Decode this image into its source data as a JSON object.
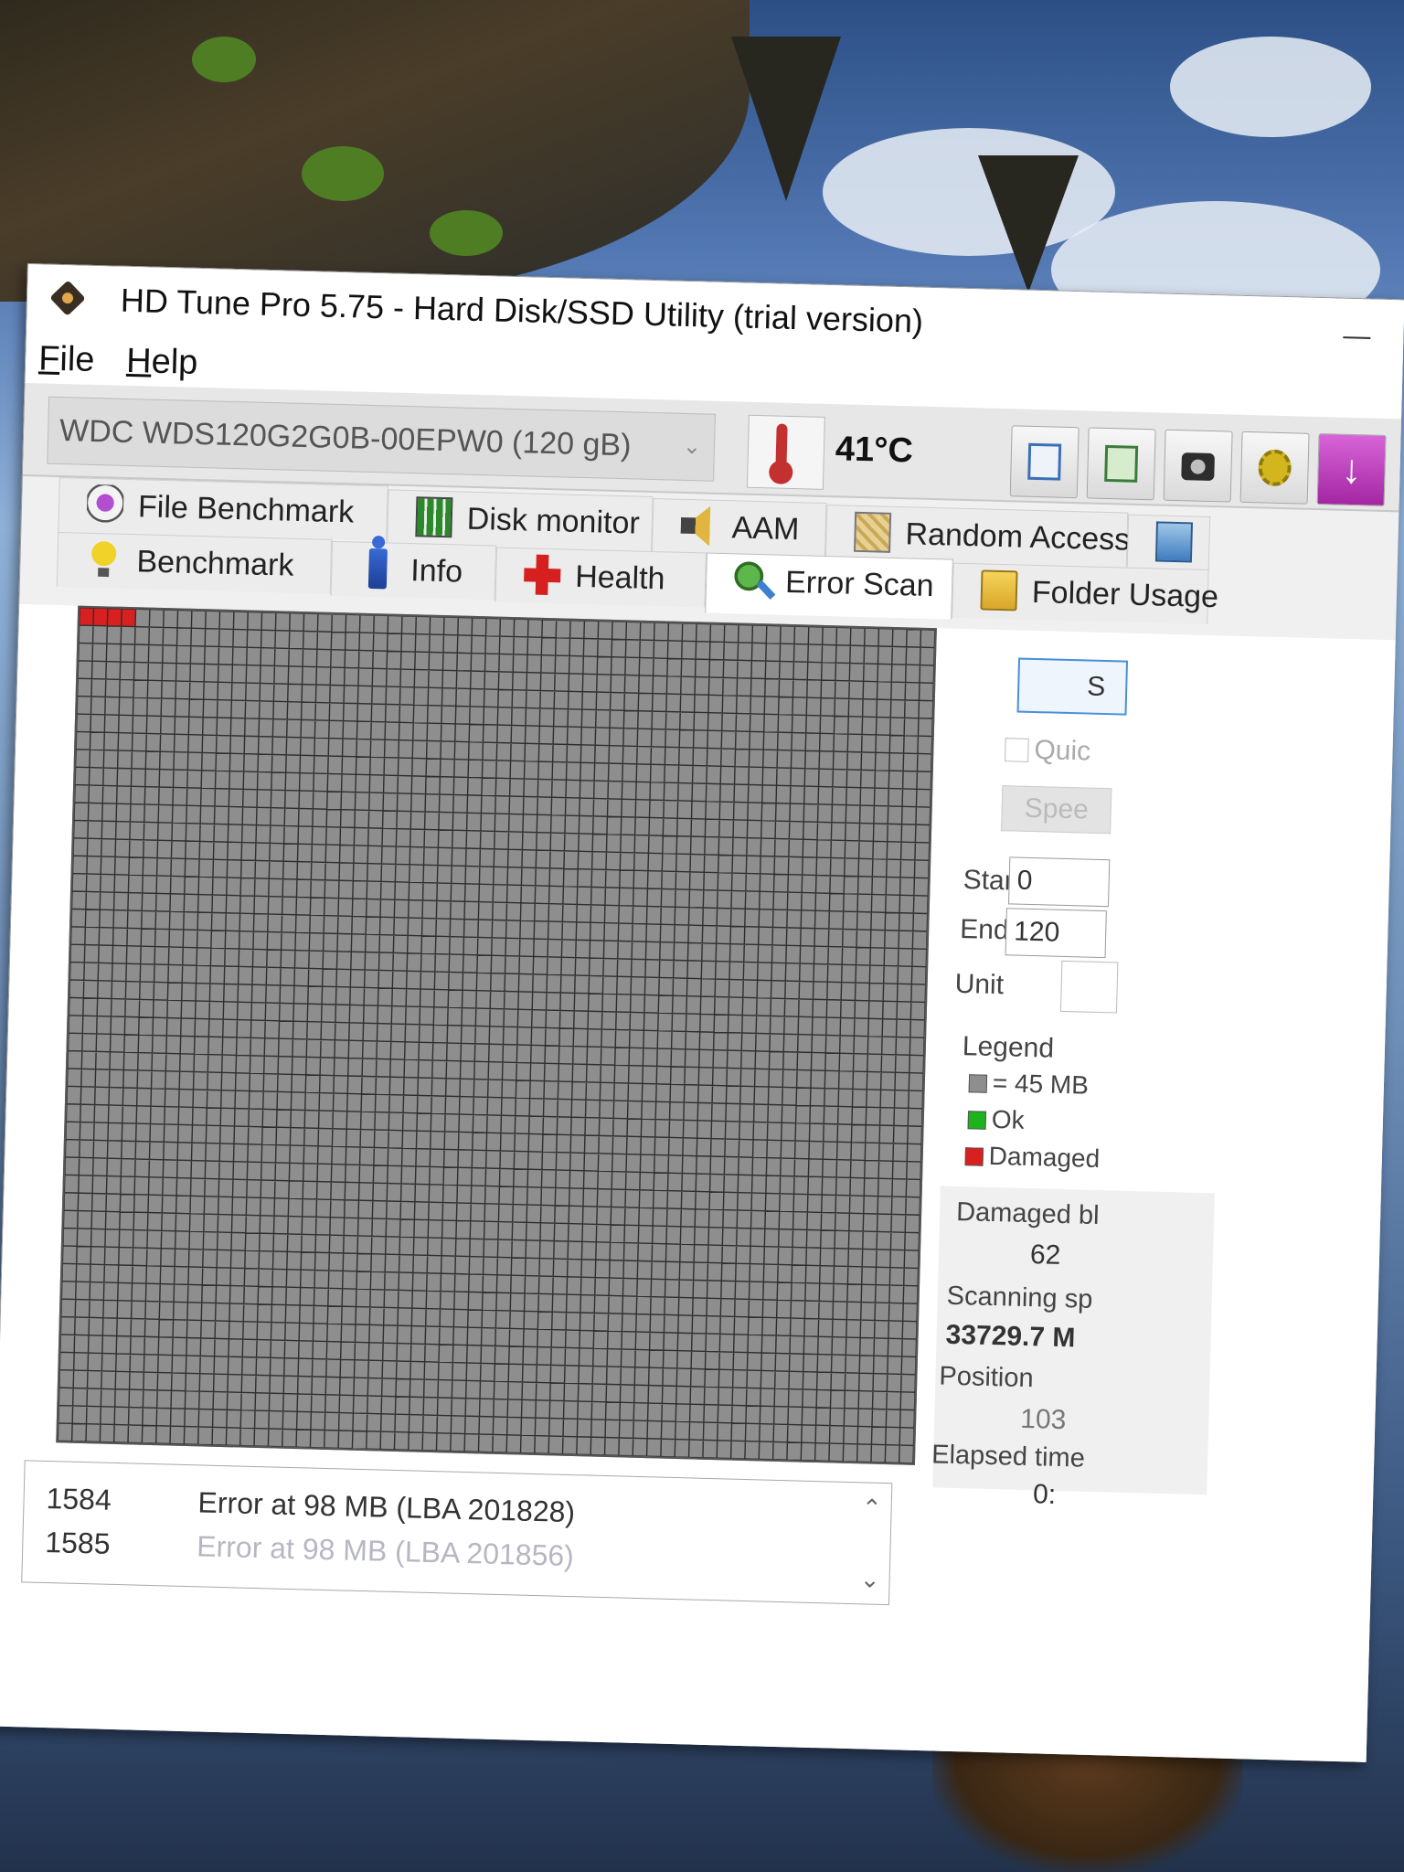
{
  "window": {
    "title": "HD Tune Pro 5.75 - Hard Disk/SSD Utility (trial version)",
    "minimize": "—"
  },
  "menu": {
    "file": "File",
    "help": "Help"
  },
  "toolbar": {
    "drive": "WDC WDS120G2G0B-00EPW0 (120 gB)",
    "dropdown_arrow": "⌄",
    "temperature": "41°C",
    "exit_glyph": "↓"
  },
  "tabs": {
    "row1": [
      "File Benchmark",
      "Disk monitor",
      "AAM",
      "Random Access",
      ""
    ],
    "row2": [
      "Benchmark",
      "Info",
      "Health",
      "Error Scan",
      "Folder Usage"
    ],
    "active": "Error Scan"
  },
  "block_map": {
    "columns": 61,
    "rows": 47,
    "damaged_blocks": 4,
    "colors": {
      "block": "#8e8e8e",
      "gridline": "#2f2f2f",
      "damaged": "#d82020",
      "ok": "#1db31d"
    }
  },
  "log": {
    "rows": [
      {
        "num": "1584",
        "msg": "Error at 98 MB (LBA 201828)"
      },
      {
        "num": "1585",
        "msg": "Error at 98 MB (LBA 201856)"
      }
    ],
    "scroll_up": "⌃",
    "scroll_down": "⌄"
  },
  "side": {
    "start_button": "S",
    "quick_scan": "Quic",
    "speed_button": "Spee",
    "start_label": "Start",
    "start_value": "0",
    "end_label": "End",
    "end_value": "120",
    "unit_label": "Unit",
    "legend_label": "Legend",
    "legend_block": "= 45 MB",
    "legend_ok": "Ok",
    "legend_damaged": "Damaged",
    "damaged_label": "Damaged bl",
    "damaged_value": "62",
    "speed_label": "Scanning sp",
    "speed_value": "33729.7 M",
    "position_label": "Position",
    "position_value": "103",
    "elapsed_label": "Elapsed time",
    "elapsed_value": "0:"
  }
}
